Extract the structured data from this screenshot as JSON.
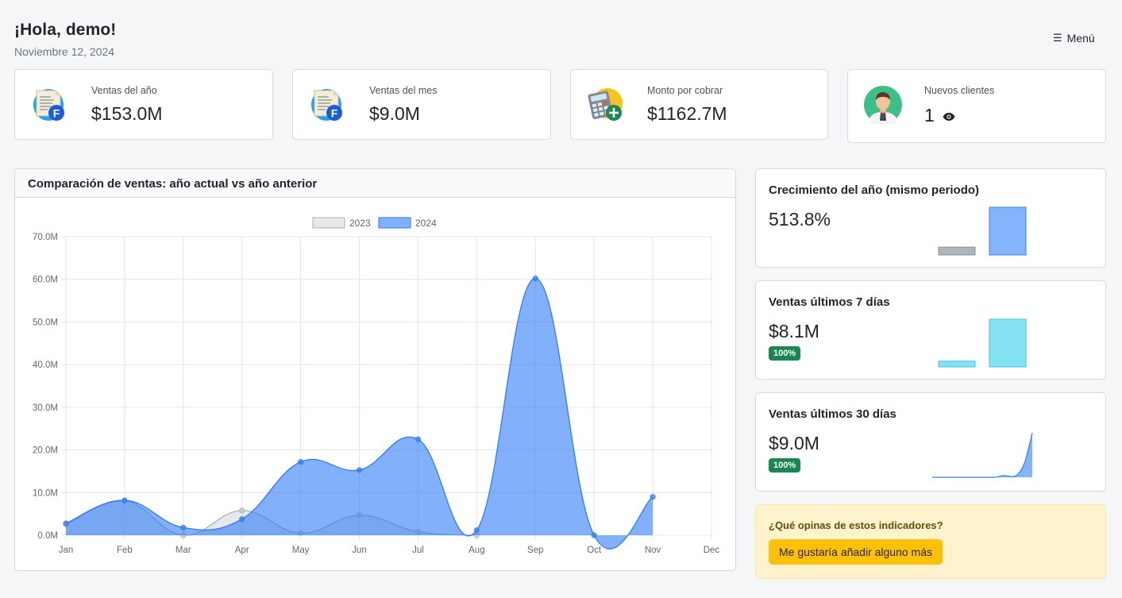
{
  "header": {
    "greeting": "¡Hola, demo!",
    "date": "Noviembre 12, 2024",
    "menu_label": "Menú"
  },
  "stats": [
    {
      "label": "Ventas del año",
      "value": "$153.0M",
      "icon": "invoice-icon"
    },
    {
      "label": "Ventas del mes",
      "value": "$9.0M",
      "icon": "invoice-icon"
    },
    {
      "label": "Monto por cobrar",
      "value": "$1162.7M",
      "icon": "calculator-icon"
    },
    {
      "label": "Nuevos clientes",
      "value": "1",
      "icon": "customer-icon"
    }
  ],
  "main_chart": {
    "title": "Comparación de ventas: año actual vs año anterior"
  },
  "chart_data": {
    "type": "area",
    "categories": [
      "Jan",
      "Feb",
      "Mar",
      "Apr",
      "May",
      "Jun",
      "Jul",
      "Aug",
      "Sep",
      "Oct",
      "Nov",
      "Dec"
    ],
    "series": [
      {
        "name": "2023",
        "values": [
          2.5,
          8.0,
          0,
          5.8,
          0.5,
          4.7,
          0.8,
          0,
          null,
          null,
          null,
          null
        ],
        "color": "#c9cbcf"
      },
      {
        "name": "2024",
        "values": [
          2.8,
          8.2,
          1.8,
          3.8,
          17.2,
          15.3,
          22.5,
          1.2,
          60.2,
          0,
          9.0,
          null
        ],
        "color": "#2f7cf6"
      }
    ],
    "y_ticks": [
      "0.0M",
      "10.0M",
      "20.0M",
      "30.0M",
      "40.0M",
      "50.0M",
      "60.0M",
      "70.0M"
    ],
    "ylim": [
      0,
      70
    ],
    "legend_position": "top",
    "grid": true
  },
  "mini_cards": {
    "growth": {
      "title": "Crecimiento del año (mismo periodo)",
      "value": "513.8%",
      "bars": [
        1,
        6.13
      ]
    },
    "week": {
      "title": "Ventas últimos 7 días",
      "value": "$8.1M",
      "badge": "100%",
      "bars": [
        0.12,
        1
      ]
    },
    "month": {
      "title": "Ventas últimos 30 días",
      "value": "$9.0M",
      "badge": "100%",
      "trend": [
        0,
        0,
        0,
        0,
        0,
        0,
        0,
        0,
        0,
        0,
        0,
        0,
        0,
        0,
        0,
        0,
        0,
        0,
        0.3,
        1.2,
        1.8,
        1.5,
        0.8,
        1.2,
        3.5,
        9,
        18,
        33,
        50
      ]
    }
  },
  "feedback": {
    "question": "¿Qué opinas de estos indicadores?",
    "button_label": "Me gustaría añadir alguno más"
  },
  "colors": {
    "accent": "#2f7cf6",
    "success": "#198754",
    "warning": "#ffc107"
  }
}
